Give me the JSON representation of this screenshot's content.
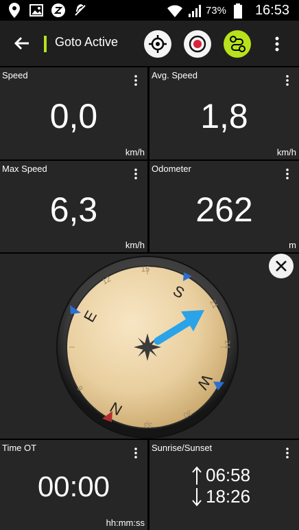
{
  "status_bar": {
    "battery": "73%",
    "time": "16:53",
    "icons": [
      "location-icon",
      "gallery-icon",
      "zedge-icon",
      "nfc-icon",
      "wifi-icon",
      "signal-icon",
      "battery-icon"
    ]
  },
  "toolbar": {
    "title": "Goto Active",
    "accent": "#b4e21e"
  },
  "tiles": {
    "speed": {
      "label": "Speed",
      "value": "0,0",
      "unit": "km/h"
    },
    "avg_speed": {
      "label": "Avg. Speed",
      "value": "1,8",
      "unit": "km/h"
    },
    "max_speed": {
      "label": "Max Speed",
      "value": "6,3",
      "unit": "km/h"
    },
    "odometer": {
      "label": "Odometer",
      "value": "262",
      "unit": "m"
    },
    "time_ot": {
      "label": "Time OT",
      "value": "00:00",
      "unit": "hh:mm:ss"
    },
    "sunrise": {
      "label": "Sunrise/Sunset",
      "sunrise": "06:58",
      "sunset": "18:26"
    }
  },
  "compass": {
    "letters": {
      "n": "N",
      "e": "E",
      "s": "S",
      "w": "W"
    },
    "degrees": [
      "3",
      "6",
      "12",
      "15",
      "21",
      "24",
      "30",
      "33"
    ]
  }
}
